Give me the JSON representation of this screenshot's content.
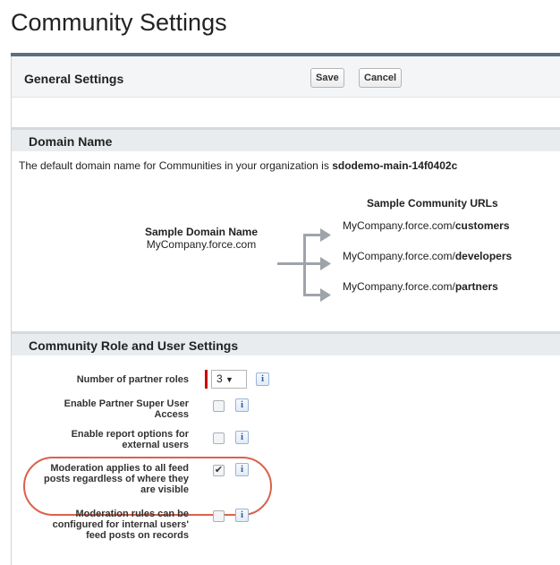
{
  "page": {
    "title": "Community Settings"
  },
  "general": {
    "title": "General Settings",
    "save_label": "Save",
    "cancel_label": "Cancel"
  },
  "domain": {
    "section_title": "Domain Name",
    "description_prefix": "The default domain name for Communities in your organization is ",
    "description_domain": "sdodemo-main-14f0402c",
    "sample_domain_title": "Sample Domain Name",
    "sample_domain_value": "MyCompany.force.com",
    "sample_urls_title": "Sample Community URLs",
    "urls": [
      {
        "prefix": "MyCompany.force.com/",
        "suffix": "customers"
      },
      {
        "prefix": "MyCompany.force.com/",
        "suffix": "developers"
      },
      {
        "prefix": "MyCompany.force.com/",
        "suffix": "partners"
      }
    ]
  },
  "roles": {
    "section_title": "Community Role and User Settings",
    "partner_roles_label": "Number of partner roles",
    "partner_roles_value": "3",
    "fields": [
      {
        "label": "Enable Partner Super User Access",
        "checked": false
      },
      {
        "label": "Enable report options for external users",
        "checked": false
      },
      {
        "label": "Moderation applies to all feed posts regardless of where they are visible",
        "checked": true
      },
      {
        "label": "Moderation rules can be configured for internal users' feed posts on records",
        "checked": false
      }
    ],
    "info_icon_glyph": "i",
    "checkmark_glyph": "✔",
    "dropdown_glyph": "▼",
    "highlight_color": "#d9624c",
    "required_color": "#cc0000"
  }
}
